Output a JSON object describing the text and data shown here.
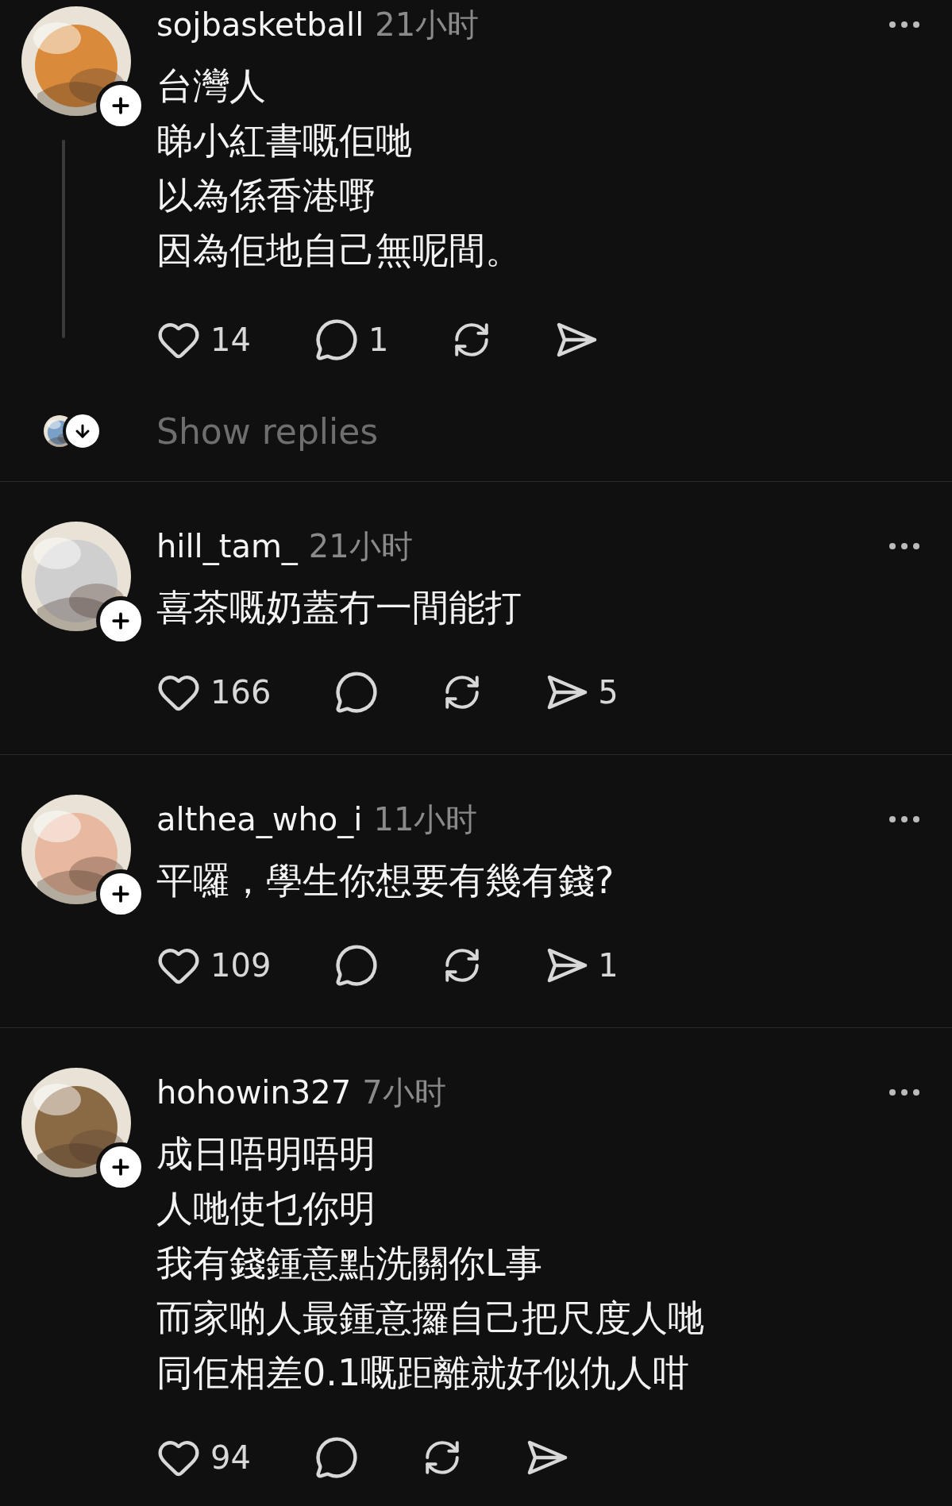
{
  "posts": [
    {
      "username": "sojbasketball",
      "time": "21小时",
      "lines": [
        "台灣人",
        "睇小紅書嘅佢哋",
        "以為係香港嘢",
        "因為佢地自己無呢間。"
      ],
      "thread_line": true,
      "actions": [
        {
          "kind": "like",
          "count": "14"
        },
        {
          "kind": "comment",
          "count": "1"
        },
        {
          "kind": "repost"
        },
        {
          "kind": "share"
        }
      ],
      "show_replies": "Show replies"
    },
    {
      "username": "hill_tam_",
      "time": "21小时",
      "lines": [
        "喜茶嘅奶蓋冇一間能打"
      ],
      "thread_line": false,
      "actions": [
        {
          "kind": "like",
          "count": "166"
        },
        {
          "kind": "comment"
        },
        {
          "kind": "repost"
        },
        {
          "kind": "share",
          "count": "5"
        }
      ]
    },
    {
      "username": "althea_who_i",
      "time": "11小时",
      "lines": [
        "平囉，學生你想要有幾有錢?"
      ],
      "thread_line": false,
      "actions": [
        {
          "kind": "like",
          "count": "109"
        },
        {
          "kind": "comment"
        },
        {
          "kind": "repost"
        },
        {
          "kind": "share",
          "count": "1"
        }
      ]
    },
    {
      "username": "hohowin327",
      "time": "7小时",
      "lines": [
        "成日唔明唔明",
        "人哋使乜你明",
        "我有錢鍾意點洗關你L事",
        "而家啲人最鍾意攞自己把尺度人哋",
        "同佢相差0.1嘅距離就好似仇人咁"
      ],
      "thread_line": false,
      "actions": [
        {
          "kind": "like",
          "count": "94"
        },
        {
          "kind": "comment"
        },
        {
          "kind": "repost"
        },
        {
          "kind": "share"
        }
      ]
    }
  ]
}
